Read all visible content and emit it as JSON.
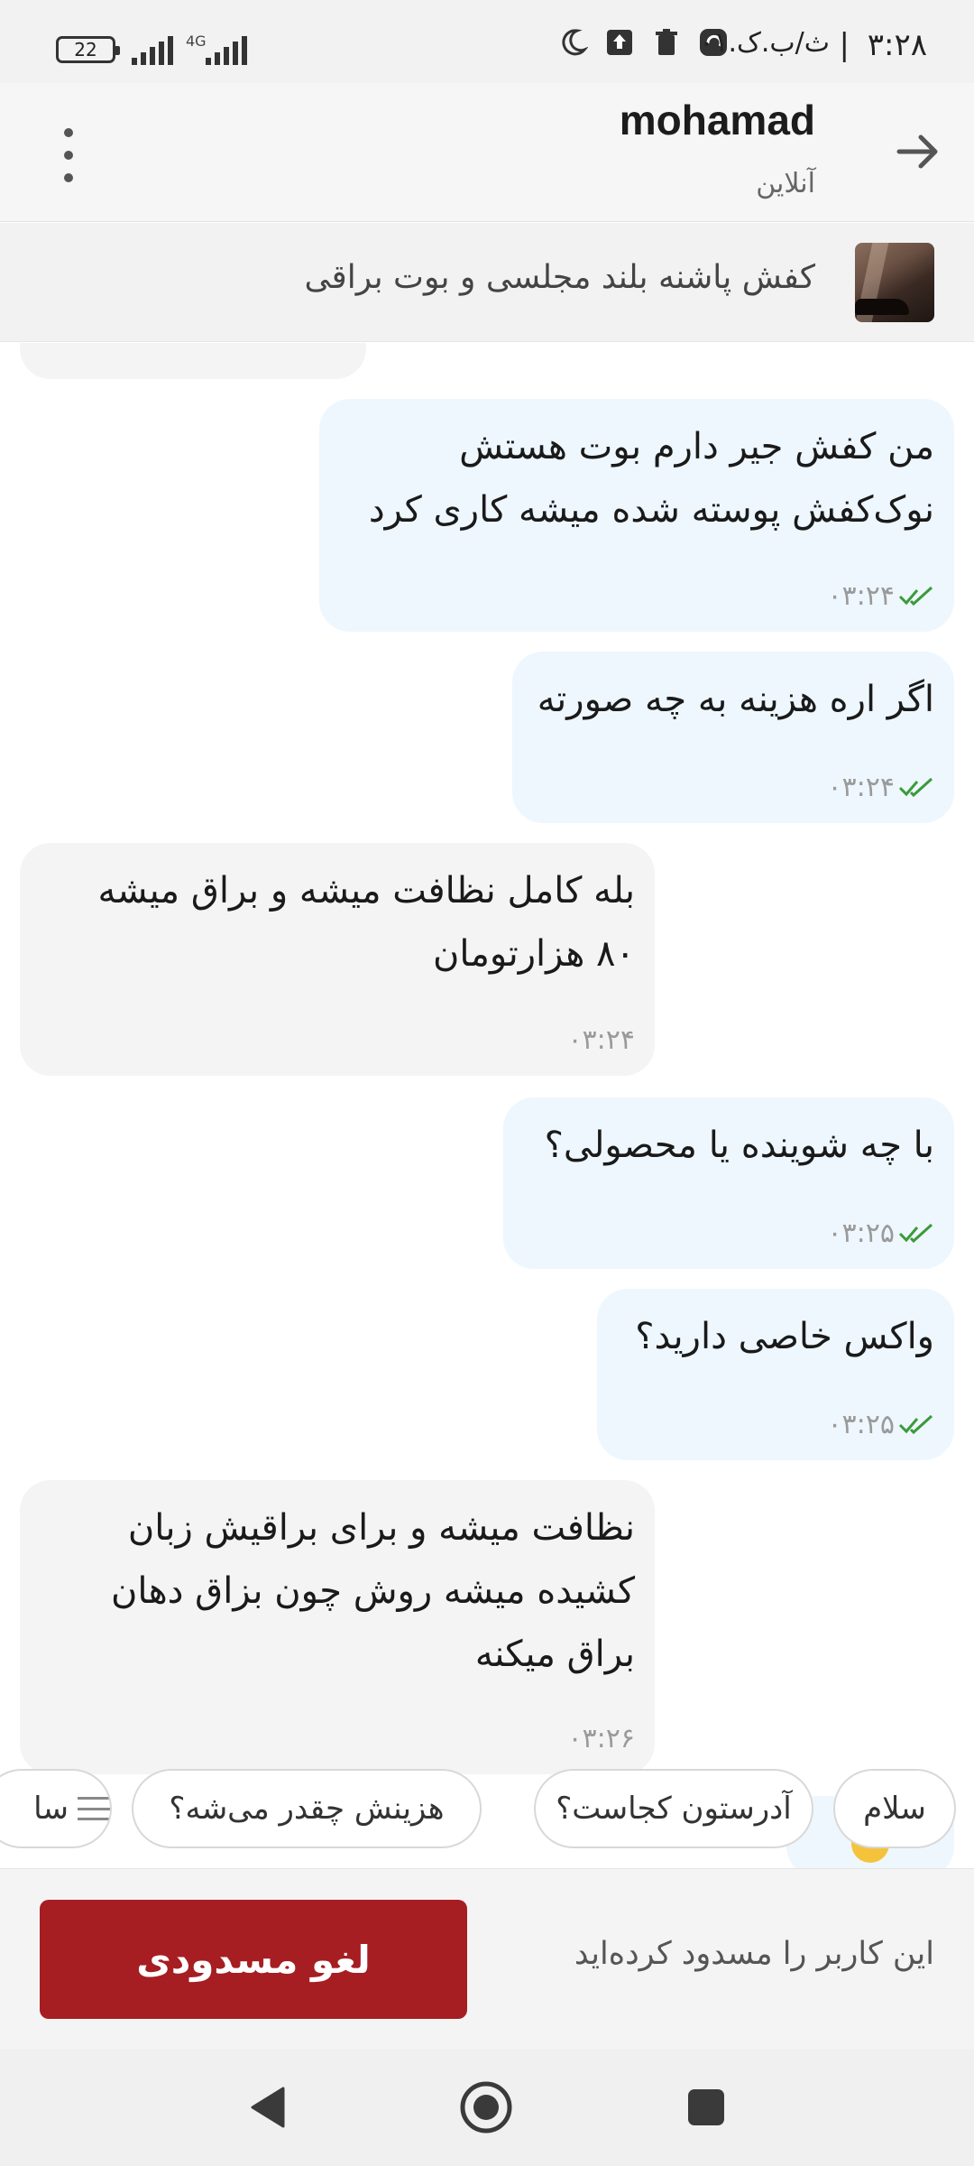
{
  "status_bar": {
    "time": "۳:۲۸",
    "date": "ث/ب.ک.۰۱",
    "battery": "22",
    "network": "4G"
  },
  "header": {
    "contact_name": "mohamad",
    "contact_status": "آنلاین",
    "icons": {
      "back": "arrow-right-icon",
      "more": "more-vertical-icon"
    }
  },
  "product": {
    "title": "کفش پاشنه بلند مجلسی و بوت براقی",
    "thumb_icon": "shoe-thumbnail"
  },
  "messages": [
    {
      "direction": "out",
      "text": "من کفش جیر دارم بوت هستش\nنوک‌کفش پوسته شده میشه کاری کرد",
      "time": "۰۳:۲۴",
      "read": true
    },
    {
      "direction": "out",
      "text": "اگر اره هزینه به چه صورته",
      "time": "۰۳:۲۴",
      "read": true
    },
    {
      "direction": "in",
      "text": "بله کامل نظافت میشه و براق میشه\n۸۰ هزارتومان",
      "time": "۰۳:۲۴"
    },
    {
      "direction": "out",
      "text": "با چه شوینده یا محصولی؟",
      "time": "۰۳:۲۵",
      "read": true
    },
    {
      "direction": "out",
      "text": "واکس خاصی دارید؟",
      "time": "۰۳:۲۵",
      "read": true
    },
    {
      "direction": "in",
      "text": "نظافت میشه و برای براقیش زبان\nکشیده میشه روش چون بزاق دهان\nبراق میکنه",
      "time": "۰۳:۲۶"
    }
  ],
  "quick_replies": [
    "سلام",
    "آدرستون کجاست؟",
    "هزینش چقدر می‌شه؟",
    "سا"
  ],
  "footer": {
    "blocked_text": "این کاربر را مسدود کرده‌اید",
    "unblock_label": "لغو مسدودی"
  },
  "colors": {
    "out_bubble": "#eef7fd",
    "in_bubble": "#f4f4f4",
    "read_tick": "#3a9a3a",
    "unblock_button": "#a61e22"
  }
}
